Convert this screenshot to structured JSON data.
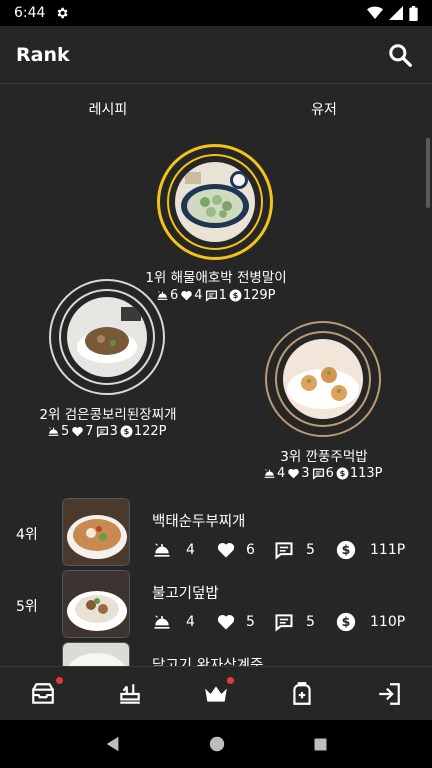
{
  "status_bar": {
    "time": "6:44"
  },
  "app_bar": {
    "title": "Rank"
  },
  "tabs": [
    {
      "label": "레시피"
    },
    {
      "label": "유저"
    }
  ],
  "podium": [
    {
      "rank_label": "1위 해물애호박 전병말이",
      "views": "6",
      "likes": "4",
      "comments": "1",
      "points": "129P",
      "ring_color": "#f2c418"
    },
    {
      "rank_label": "2위 검은콩보리된장찌개",
      "views": "5",
      "likes": "7",
      "comments": "3",
      "points": "122P",
      "ring_color": "#d9d9d9"
    },
    {
      "rank_label": "3위 깐풍주먹밥",
      "views": "4",
      "likes": "3",
      "comments": "6",
      "points": "113P",
      "ring_color": "#b99b74"
    }
  ],
  "list": [
    {
      "rank": "4위",
      "title": "백태순두부찌개",
      "views": "4",
      "likes": "6",
      "comments": "5",
      "points": "111P"
    },
    {
      "rank": "5위",
      "title": "불고기덮밥",
      "views": "4",
      "likes": "5",
      "comments": "5",
      "points": "110P"
    },
    {
      "rank": "",
      "title": "닭고기 완자삼계죽",
      "views": "",
      "likes": "",
      "comments": "",
      "points": ""
    }
  ],
  "bottom_nav": [
    {
      "icon": "inbox-icon",
      "badge": true
    },
    {
      "icon": "cooking-icon",
      "badge": false
    },
    {
      "icon": "crown-icon",
      "badge": true
    },
    {
      "icon": "backpack-icon",
      "badge": false
    },
    {
      "icon": "logout-icon",
      "badge": false
    }
  ],
  "colors": {
    "background": "#262626",
    "badge": "#e53935",
    "gold": "#f2c418",
    "silver": "#d9d9d9",
    "bronze": "#b99b74"
  }
}
